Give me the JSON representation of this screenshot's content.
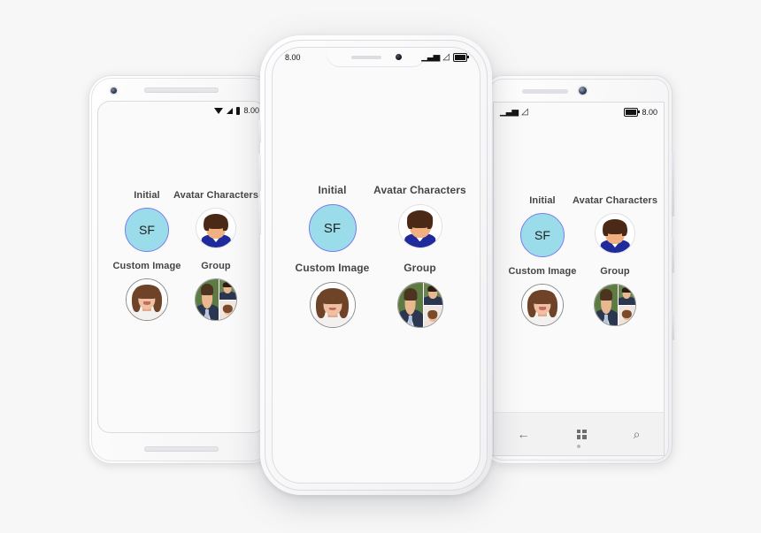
{
  "background_color": "#f7f7f7",
  "app": {
    "section_items": [
      {
        "label": "Initial",
        "type": "initial-avatar",
        "initials": "SF"
      },
      {
        "label": "Avatar Characters",
        "type": "character-avatar",
        "initials": ""
      },
      {
        "label": "Custom Image",
        "type": "image-avatar",
        "initials": ""
      },
      {
        "label": "Group",
        "type": "group-avatar",
        "initials": ""
      }
    ],
    "colors": {
      "initial_fill": "#9bdcea",
      "initial_border": "#7b7cee",
      "initial_text": "#222222",
      "label_text": "#454545",
      "screen_background": "#fafafa",
      "character_shirt": "#1f2a9c",
      "character_hair": "#4a2a16",
      "character_skin": "#f0b07f"
    }
  },
  "devices": [
    {
      "id": "android",
      "platform": "Android",
      "status_bar": {
        "time": "8.00",
        "icons": [
          "wifi-icon",
          "cellular-signal-icon",
          "battery-icon"
        ]
      }
    },
    {
      "id": "iphone",
      "platform": "iOS",
      "status_bar": {
        "time": "8.00",
        "icons": [
          "cellular-signal-icon",
          "wifi-icon",
          "battery-icon"
        ]
      }
    },
    {
      "id": "winphone",
      "platform": "Windows Phone",
      "status_bar": {
        "time": "8.00",
        "icons": [
          "cellular-signal-icon",
          "wifi-icon",
          "battery-icon"
        ]
      },
      "nav_bar": {
        "back_label": "←",
        "start_label": "",
        "search_label": "⌕"
      }
    }
  ]
}
